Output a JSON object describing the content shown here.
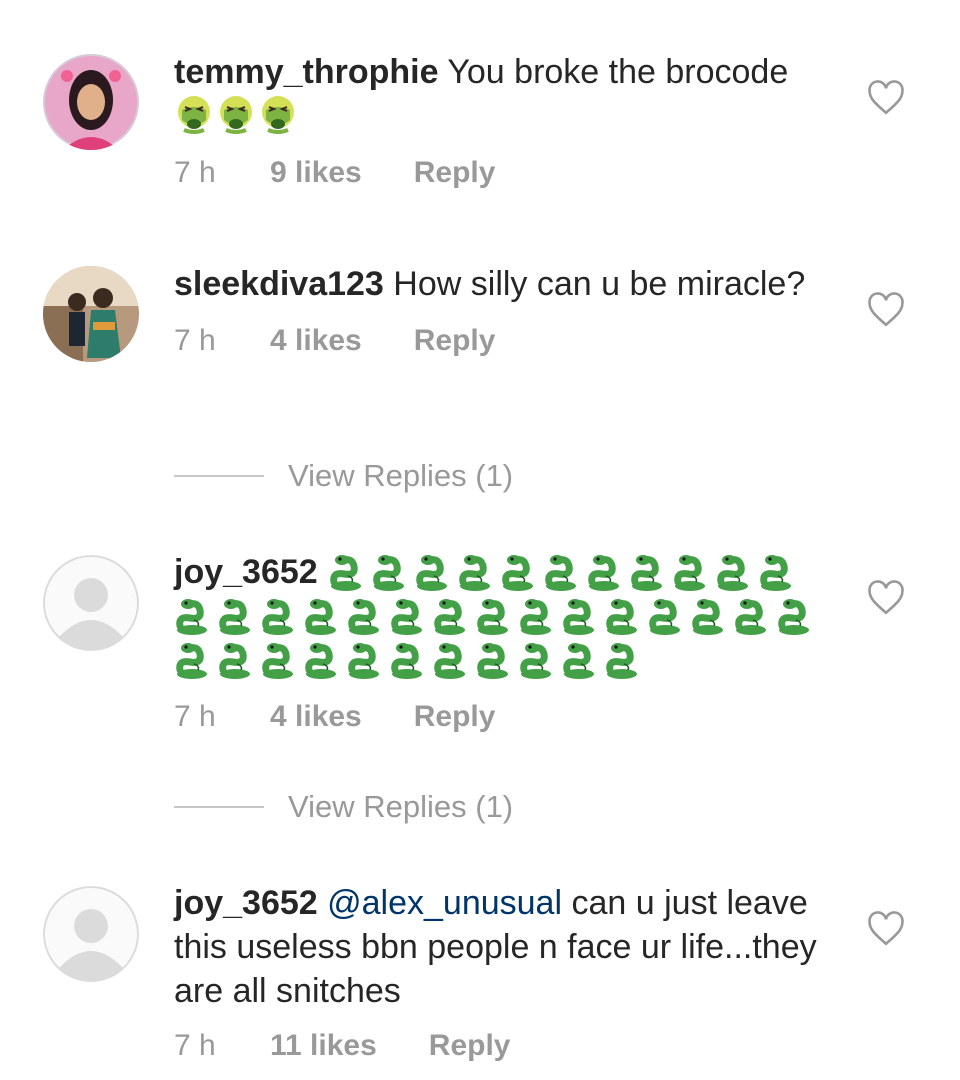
{
  "comments": [
    {
      "username": "temmy_throphie",
      "text": "You broke the brocode",
      "emoji": "nauseated-face",
      "emoji_count": 3,
      "time": "7 h",
      "likes": "9 likes",
      "reply": "Reply",
      "avatar": "photo"
    },
    {
      "username": "sleekdiva123",
      "text": "How silly can u be miracle?",
      "time": "7 h",
      "likes": "4 likes",
      "reply": "Reply",
      "avatar": "photo",
      "view_replies": "View Replies (1)"
    },
    {
      "username": "joy_3652",
      "emoji": "snake",
      "emoji_count": 37,
      "time": "7 h",
      "likes": "4 likes",
      "reply": "Reply",
      "avatar": "default",
      "view_replies": "View Replies (1)"
    },
    {
      "username": "joy_3652",
      "mention": "@alex_unusual",
      "text": "can u just leave this useless bbn people n face ur life...they are all snitches",
      "time": "7 h",
      "likes": "11 likes",
      "reply": "Reply",
      "avatar": "default"
    }
  ],
  "colors": {
    "text": "#262626",
    "muted": "#999999",
    "mention": "#003569",
    "snake": "#43a047",
    "nauseated": "#7cb342"
  }
}
